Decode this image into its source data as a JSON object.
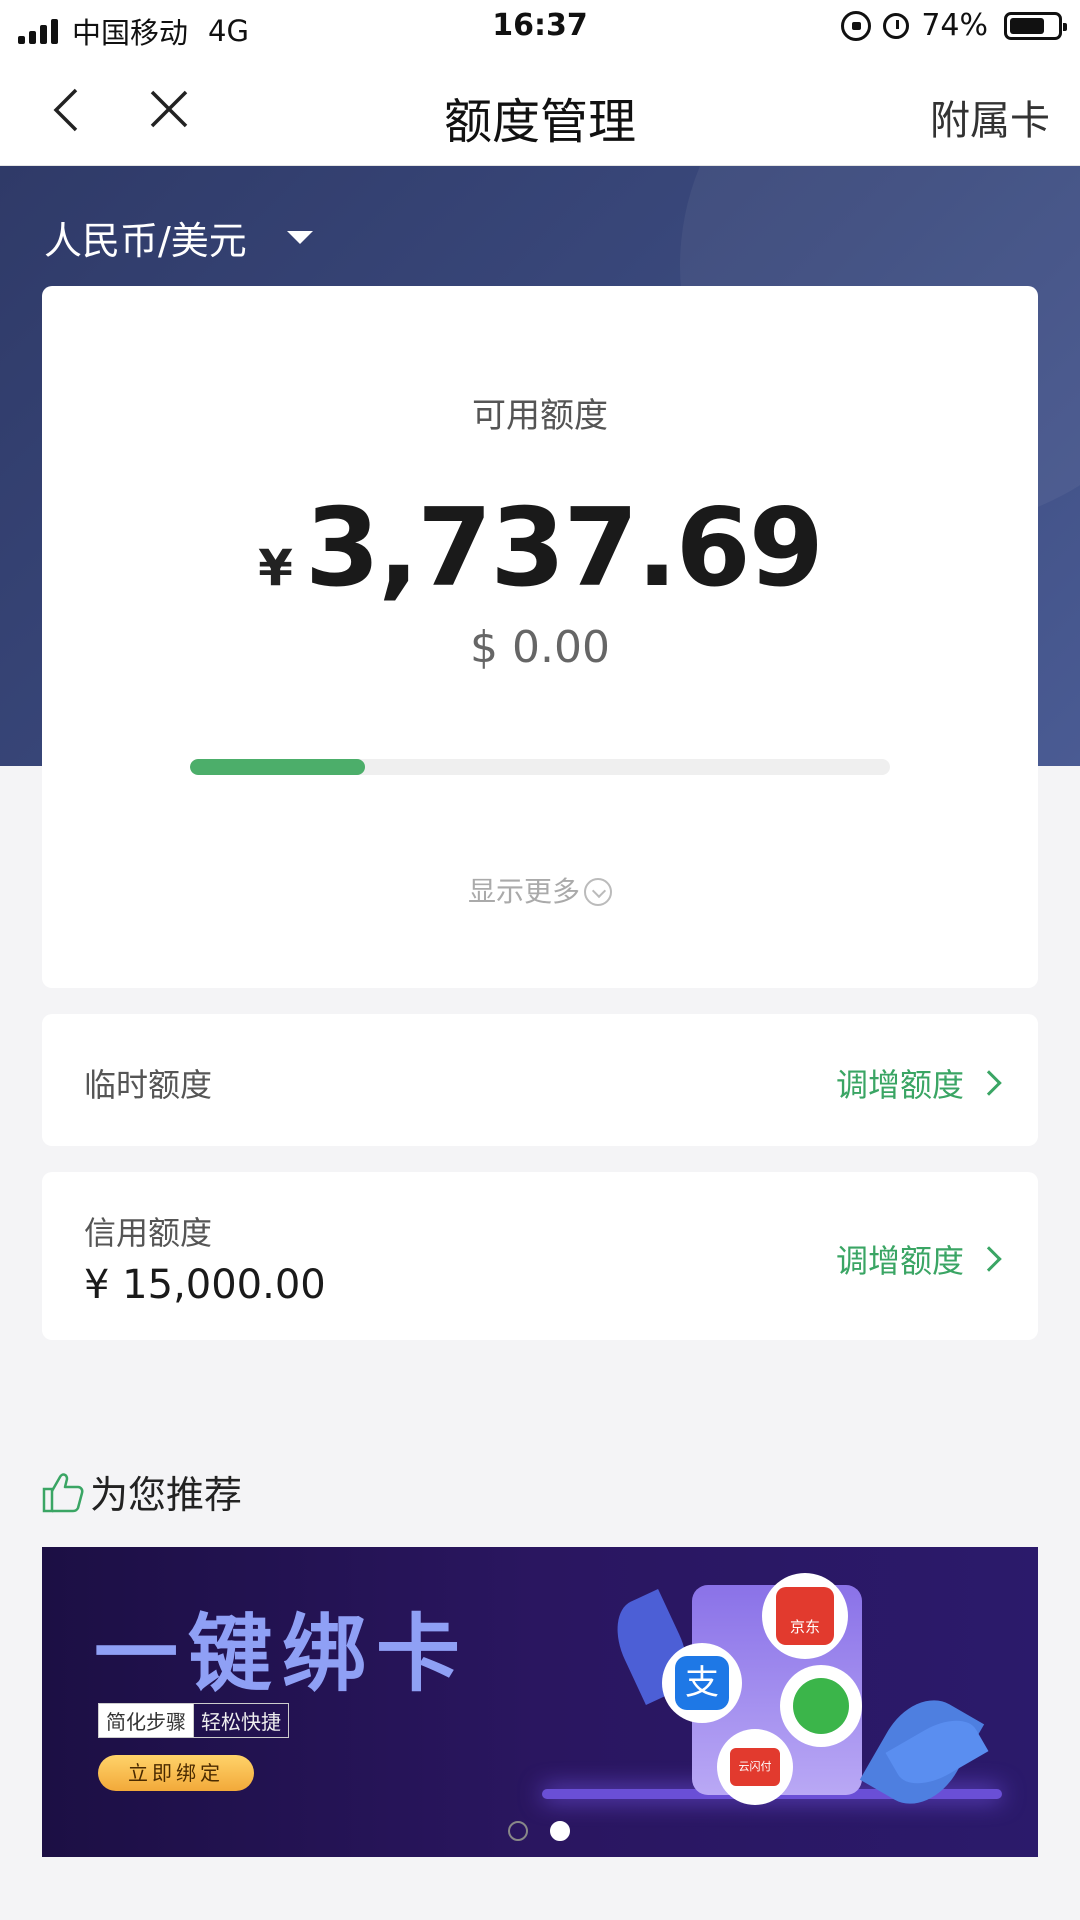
{
  "status_bar": {
    "carrier": "中国移动",
    "network": "4G",
    "time": "16:37",
    "battery": "74%",
    "battery_level": 0.74,
    "icons": [
      "signal-icon",
      "rotation-lock-icon",
      "alarm-icon",
      "battery-icon"
    ]
  },
  "nav": {
    "title": "额度管理",
    "right_label": "附属卡",
    "icons": [
      "back-icon",
      "close-icon"
    ]
  },
  "currency_switch": {
    "label": "人民币/美元",
    "icon": "caret-down-icon"
  },
  "available": {
    "label": "可用额度",
    "symbol": "¥",
    "amount": "3,737.69",
    "usd": "$ 0.00",
    "progress_fraction": 0.25,
    "progress_color": "#4cae6a",
    "show_more": "显示更多"
  },
  "temporary": {
    "label": "临时额度",
    "action": "调增额度"
  },
  "credit": {
    "label": "信用额度",
    "amount": "¥ 15,000.00",
    "action": "调增额度"
  },
  "recommend": {
    "title": "为您推荐",
    "icon": "thumbs-up-icon"
  },
  "banner": {
    "title": "一键绑卡",
    "tag1": "简化步骤",
    "tag2": "轻松快捷",
    "button": "立即绑定",
    "jd_label": "京东",
    "alipay_glyph": "支",
    "unionpay_label": "云闪付",
    "page_count": 2,
    "active_index": 1
  },
  "colors": {
    "accent_green": "#3aa564",
    "header_navy": "#2f3a68",
    "banner_bg": "#1c0f44"
  }
}
